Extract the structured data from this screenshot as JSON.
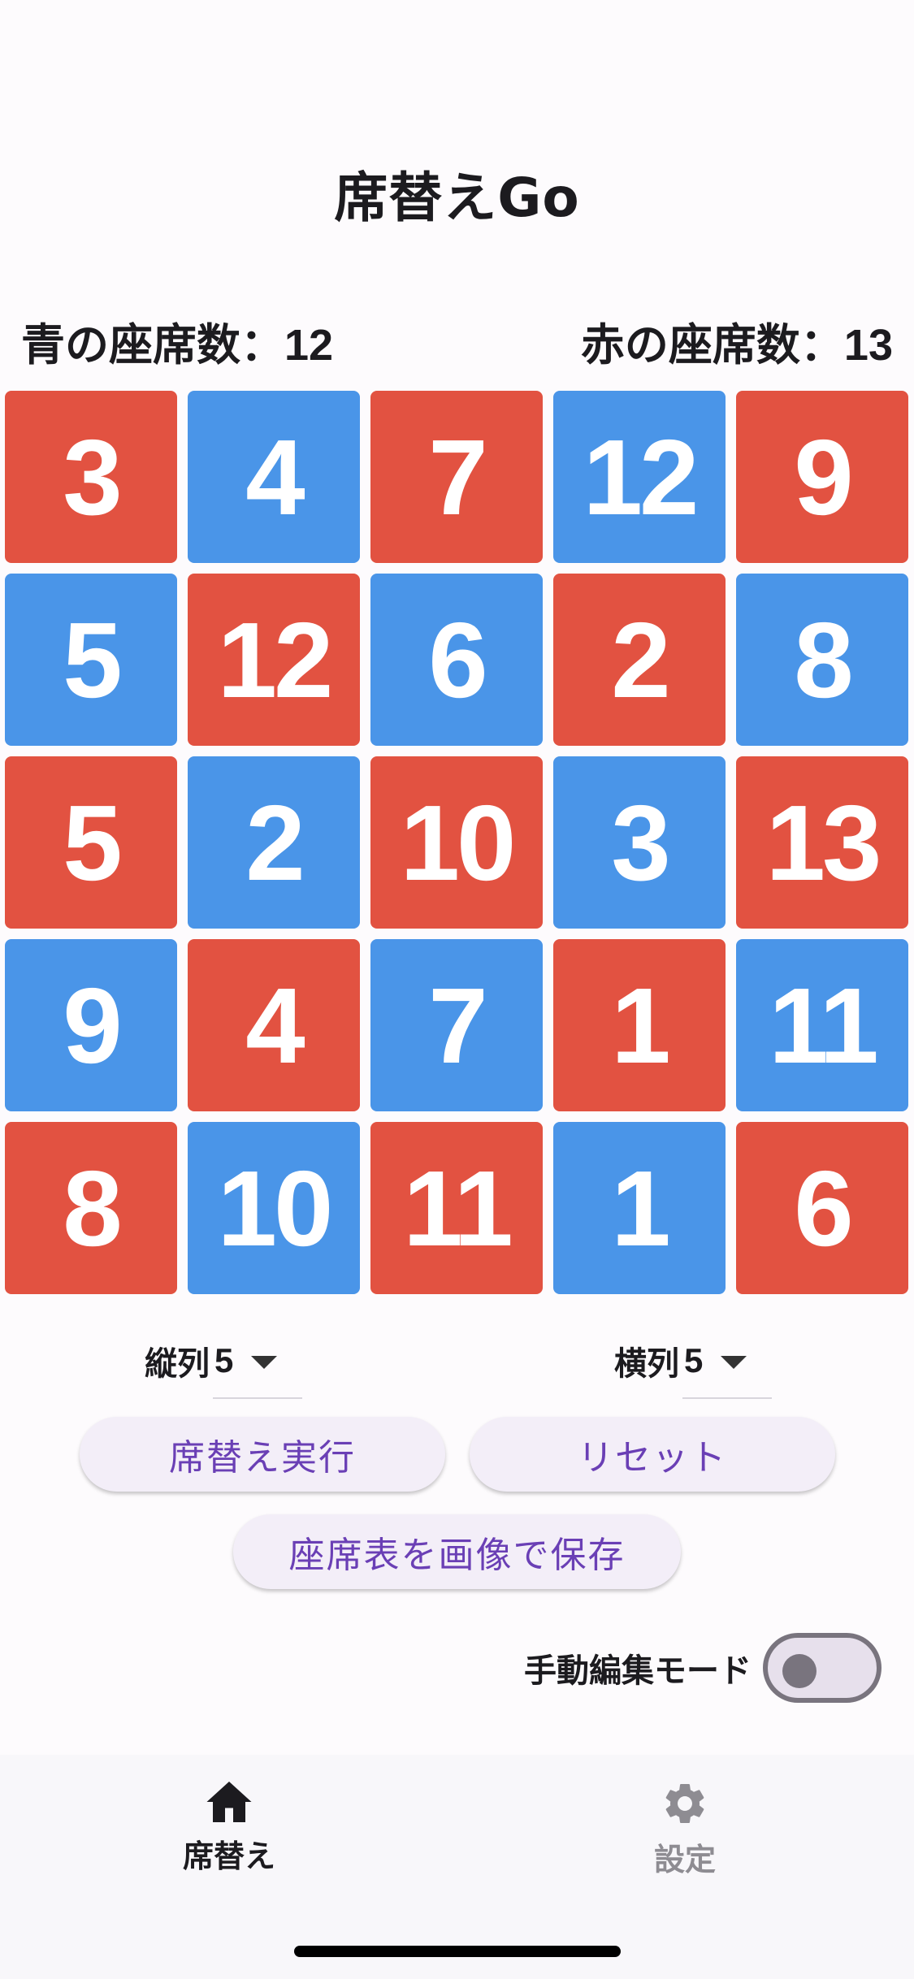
{
  "app": {
    "title": "席替えGo"
  },
  "counts": {
    "blue_label": "青の座席数：",
    "blue_value": "12",
    "red_label": "赤の座席数：",
    "red_value": "13"
  },
  "colors": {
    "red": "#e25241",
    "blue": "#4a95e8",
    "accent": "#6a3fb5"
  },
  "seats": [
    [
      {
        "n": "3",
        "c": "red"
      },
      {
        "n": "4",
        "c": "blue"
      },
      {
        "n": "7",
        "c": "red"
      },
      {
        "n": "12",
        "c": "blue"
      },
      {
        "n": "9",
        "c": "red"
      }
    ],
    [
      {
        "n": "5",
        "c": "blue"
      },
      {
        "n": "12",
        "c": "red"
      },
      {
        "n": "6",
        "c": "blue"
      },
      {
        "n": "2",
        "c": "red"
      },
      {
        "n": "8",
        "c": "blue"
      }
    ],
    [
      {
        "n": "5",
        "c": "red"
      },
      {
        "n": "2",
        "c": "blue"
      },
      {
        "n": "10",
        "c": "red"
      },
      {
        "n": "3",
        "c": "blue"
      },
      {
        "n": "13",
        "c": "red"
      }
    ],
    [
      {
        "n": "9",
        "c": "blue"
      },
      {
        "n": "4",
        "c": "red"
      },
      {
        "n": "7",
        "c": "blue"
      },
      {
        "n": "1",
        "c": "red"
      },
      {
        "n": "11",
        "c": "blue"
      }
    ],
    [
      {
        "n": "8",
        "c": "red"
      },
      {
        "n": "10",
        "c": "blue"
      },
      {
        "n": "11",
        "c": "red"
      },
      {
        "n": "1",
        "c": "blue"
      },
      {
        "n": "6",
        "c": "red"
      }
    ]
  ],
  "controls": {
    "rows_label": "縦列",
    "rows_value": "5",
    "cols_label": "横列",
    "cols_value": "5",
    "shuffle_button": "席替え実行",
    "reset_button": "リセット",
    "save_image_button": "座席表を画像で保存",
    "manual_edit_label": "手動編集モード",
    "manual_edit_on": false
  },
  "nav": {
    "items": [
      {
        "label": "席替え",
        "icon": "home-icon",
        "active": true
      },
      {
        "label": "設定",
        "icon": "gear-icon",
        "active": false
      }
    ]
  }
}
